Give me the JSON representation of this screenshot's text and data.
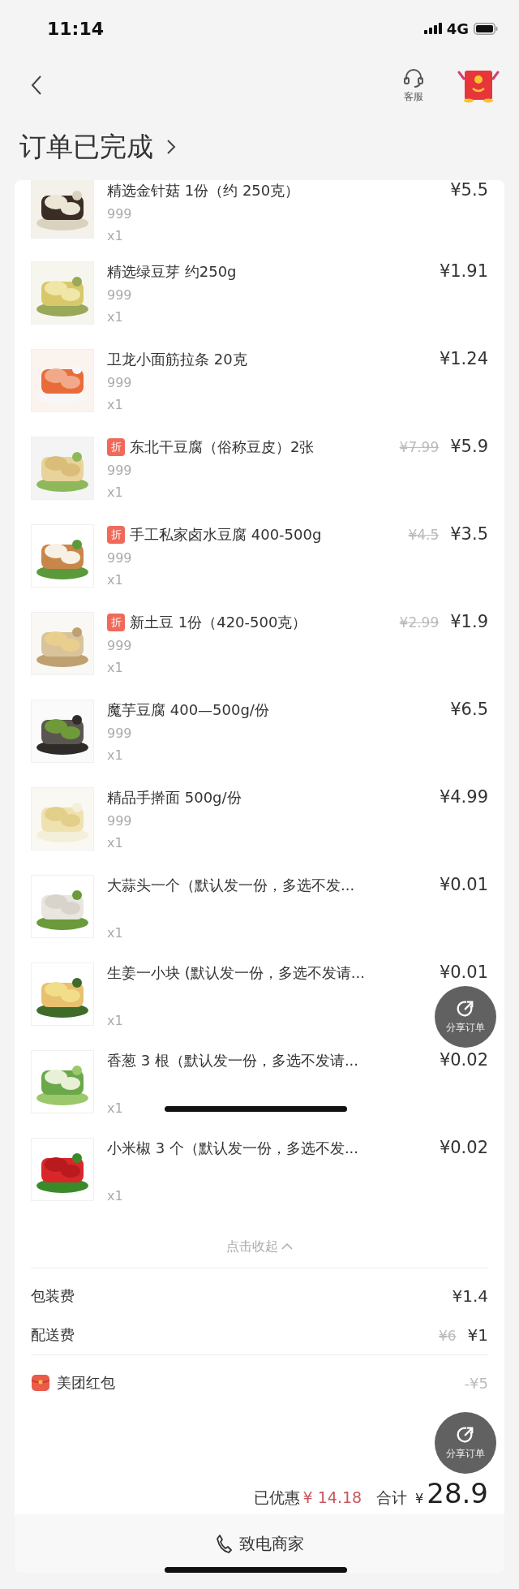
{
  "status_bar": {
    "time": "11:14",
    "network": "4G"
  },
  "nav": {
    "service_label": "客服"
  },
  "title": "订单已完成",
  "items": [
    {
      "name": "精选金针菇 1份（约 250克）",
      "spec": "999",
      "qty": "x1",
      "price": "¥5.5"
    },
    {
      "name": "精选绿豆芽 约250g",
      "spec": "999",
      "qty": "x1",
      "price": "¥1.91"
    },
    {
      "name": "卫龙小面筋拉条 20克",
      "spec": "999",
      "qty": "x1",
      "price": "¥1.24"
    },
    {
      "name": "东北干豆腐（俗称豆皮）2张",
      "spec": "999",
      "qty": "x1",
      "price": "¥5.9",
      "original_price": "¥7.99",
      "badge": "折"
    },
    {
      "name": "手工私家卤水豆腐 400-500g",
      "spec": "999",
      "qty": "x1",
      "price": "¥3.5",
      "original_price": "¥4.5",
      "badge": "折"
    },
    {
      "name": "新土豆 1份（420-500克）",
      "spec": "999",
      "qty": "x1",
      "price": "¥1.9",
      "original_price": "¥2.99",
      "badge": "折"
    },
    {
      "name": "魔芋豆腐 400—500g/份",
      "spec": "999",
      "qty": "x1",
      "price": "¥6.5"
    },
    {
      "name": "精品手擀面 500g/份",
      "spec": "999",
      "qty": "x1",
      "price": "¥4.99"
    },
    {
      "name": "大蒜头一个（默认发一份，多选不发...",
      "qty": "x1",
      "price": "¥0.01"
    },
    {
      "name": "生姜一小块 (默认发一份，多选不发请...",
      "qty": "x1",
      "price": "¥0.01"
    },
    {
      "name": "香葱 3 根（默认发一份，多选不发请...",
      "qty": "x1",
      "price": "¥0.02"
    },
    {
      "name": "小米椒 3 个（默认发一份，多选不发...",
      "qty": "x1",
      "price": "¥0.02"
    }
  ],
  "collapse": "点击收起",
  "fees": [
    {
      "label": "包装费",
      "price": "¥1.4"
    },
    {
      "label": "配送费",
      "original_price": "¥6",
      "price": "¥1"
    }
  ],
  "red_packet": {
    "label": "美团红包",
    "amount": "-¥5"
  },
  "summary": {
    "saved_label": "已优惠",
    "saved": "¥ 14.18",
    "total_label": "合计",
    "currency": "¥",
    "total": "28.9"
  },
  "share_buttons": [
    {
      "label": "分享订单"
    },
    {
      "label": "分享订单"
    }
  ],
  "call_button": "致电商家"
}
